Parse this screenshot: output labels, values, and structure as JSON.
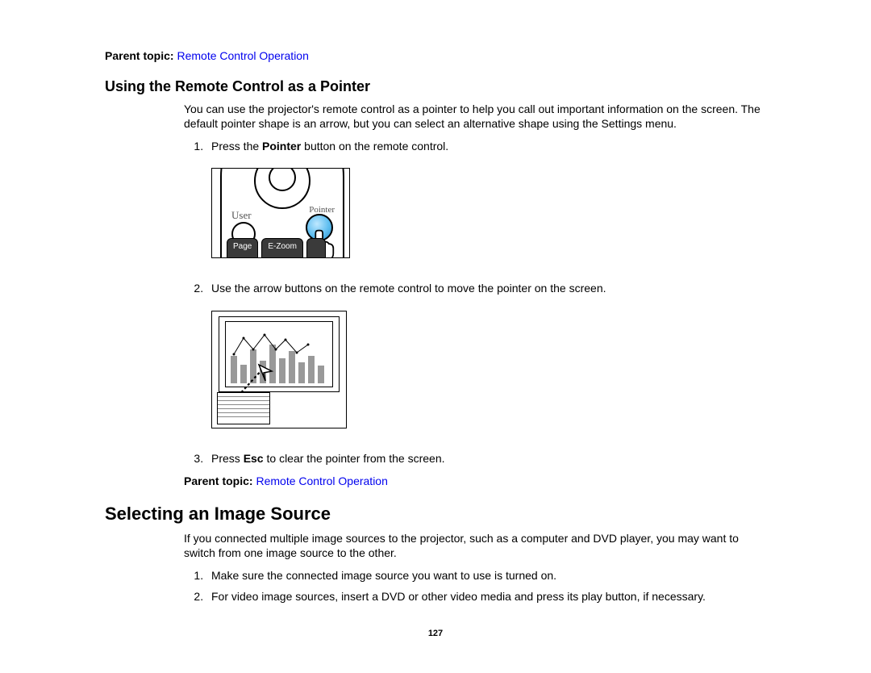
{
  "parent_topic_label": "Parent topic:",
  "parent_topic_link": "Remote Control Operation",
  "section1": {
    "heading": "Using the Remote Control as a Pointer",
    "intro": "You can use the projector's remote control as a pointer to help you call out important information on the screen. The default pointer shape is an arrow, but you can select an alternative shape using the Settings menu.",
    "step1_a": "Press the ",
    "step1_bold": "Pointer",
    "step1_b": " button on the remote control.",
    "remote_labels": {
      "user": "User",
      "pointer": "Pointer",
      "page": "Page",
      "ezoom": "E-Zoom"
    },
    "step2": "Use the arrow buttons on the remote control to move the pointer on the screen.",
    "step3_a": "Press ",
    "step3_bold": "Esc",
    "step3_b": " to clear the pointer from the screen."
  },
  "section2": {
    "heading": "Selecting an Image Source",
    "intro": "If you connected multiple image sources to the projector, such as a computer and DVD player, you may want to switch from one image source to the other.",
    "step1": "Make sure the connected image source you want to use is turned on.",
    "step2": "For video image sources, insert a DVD or other video media and press its play button, if necessary."
  },
  "page_number": "127"
}
